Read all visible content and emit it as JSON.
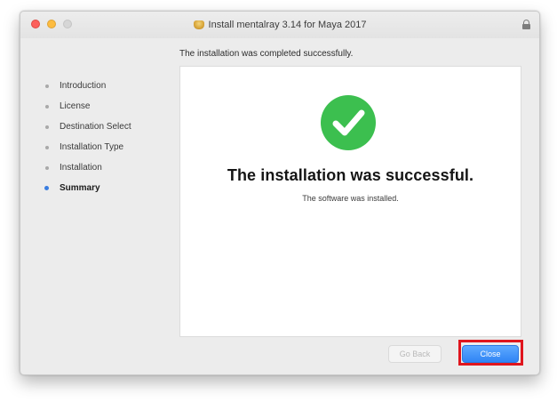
{
  "window": {
    "title": "Install mentalray 3.14 for Maya 2017",
    "title_icon": "installer-package-icon",
    "lock_icon": "lock-icon"
  },
  "header": {
    "status_text": "The installation was completed successfully."
  },
  "sidebar": {
    "items": [
      {
        "label": "Introduction",
        "active": false
      },
      {
        "label": "License",
        "active": false
      },
      {
        "label": "Destination Select",
        "active": false
      },
      {
        "label": "Installation Type",
        "active": false
      },
      {
        "label": "Installation",
        "active": false
      },
      {
        "label": "Summary",
        "active": true
      }
    ]
  },
  "main": {
    "success_icon": "checkmark-circle-icon",
    "success_title": "The installation was successful.",
    "success_subtitle": "The software was installed."
  },
  "footer": {
    "go_back_label": "Go Back",
    "close_label": "Close"
  },
  "colors": {
    "accent_blue": "#2f84f5",
    "success_green": "#3cbf4f",
    "highlight_red": "#e0151d"
  }
}
